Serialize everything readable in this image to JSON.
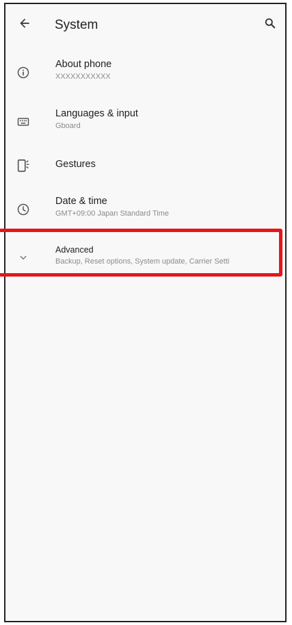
{
  "appbar": {
    "title": "System",
    "back_icon": "arrow-left-icon",
    "search_icon": "search-icon"
  },
  "items": [
    {
      "title": "About phone",
      "subtitle": "XXXXXXXXXXX",
      "icon": "info-icon"
    },
    {
      "title": "Languages & input",
      "subtitle": "Gboard",
      "icon": "keyboard-icon"
    },
    {
      "title": "Gestures",
      "subtitle": "",
      "icon": "gesture-phone-icon"
    },
    {
      "title": "Date & time",
      "subtitle": "GMT+09:00 Japan Standard Time",
      "icon": "clock-icon"
    },
    {
      "title": "Advanced",
      "subtitle": "Backup, Reset options, System update, Carrier Setti",
      "icon": "chevron-down-icon"
    }
  ],
  "colors": {
    "highlight": "#e8141b",
    "icon": "#555555",
    "background": "#f8f8f8"
  }
}
